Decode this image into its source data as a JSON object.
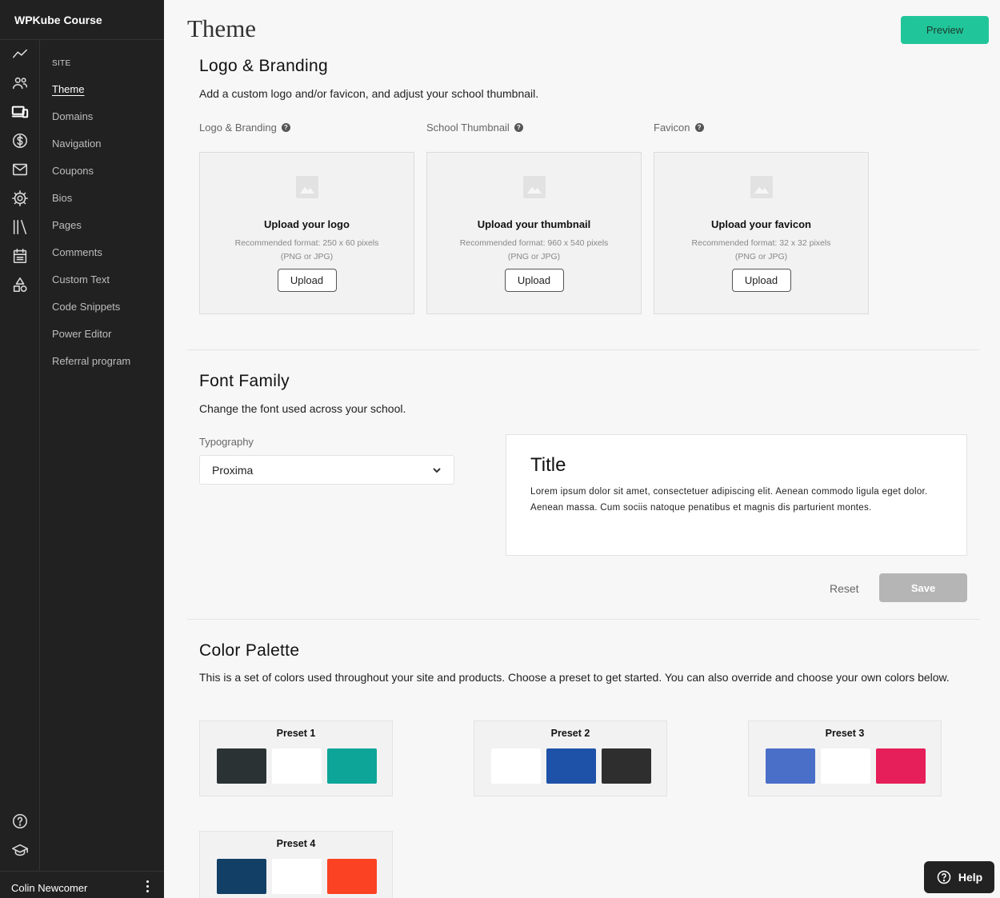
{
  "app": {
    "title": "WPKube Course"
  },
  "rail": {
    "icons": [
      "analytics-icon",
      "users-icon",
      "devices-icon",
      "dollar-icon",
      "mail-icon",
      "settings-icon",
      "library-icon",
      "calendar-icon",
      "shapes-icon",
      "help-circle-icon",
      "graduation-cap-icon"
    ]
  },
  "subnav": {
    "section": "SITE",
    "items": [
      "Theme",
      "Domains",
      "Navigation",
      "Coupons",
      "Bios",
      "Pages",
      "Comments",
      "Custom Text",
      "Code Snippets",
      "Power Editor",
      "Referral program"
    ],
    "active": "Theme"
  },
  "user": {
    "name": "Colin Newcomer"
  },
  "header": {
    "title": "Theme",
    "preview_label": "Preview"
  },
  "branding": {
    "title": "Logo & Branding",
    "description": "Add a custom logo and/or favicon, and adjust your school thumbnail.",
    "cards": [
      {
        "label": "Logo & Branding",
        "title": "Upload your logo",
        "rec": "Recommended format: 250 x 60 pixels",
        "fmt": "(PNG or JPG)",
        "button": "Upload"
      },
      {
        "label": "School Thumbnail",
        "title": "Upload your thumbnail",
        "rec": "Recommended format: 960 x 540 pixels",
        "fmt": "(PNG or JPG)",
        "button": "Upload"
      },
      {
        "label": "Favicon",
        "title": "Upload your favicon",
        "rec": "Recommended format: 32 x 32 pixels",
        "fmt": "(PNG or JPG)",
        "button": "Upload"
      }
    ]
  },
  "font": {
    "title": "Font Family",
    "description": "Change the font used across your school.",
    "typography_label": "Typography",
    "selected": "Proxima",
    "preview_title": "Title",
    "preview_body": "Lorem ipsum dolor sit amet, consectetuer adipiscing elit. Aenean commodo ligula eget dolor. Aenean massa. Cum sociis natoque penatibus et magnis dis parturient montes.",
    "reset_label": "Reset",
    "save_label": "Save"
  },
  "palette": {
    "title": "Color Palette",
    "description": "This is a set of colors used throughout your site and products. Choose a preset to get started. You can also override and choose your own colors below.",
    "presets": [
      {
        "name": "Preset 1",
        "colors": [
          "#2b3234",
          "#ffffff",
          "#0ea599"
        ]
      },
      {
        "name": "Preset 2",
        "colors": [
          "#ffffff",
          "#1e52a8",
          "#2e2e2e"
        ]
      },
      {
        "name": "Preset 3",
        "colors": [
          "#4a6fc9",
          "#ffffff",
          "#e61e59"
        ]
      },
      {
        "name": "Preset 4",
        "colors": [
          "#123f66",
          "#ffffff",
          "#fb4222"
        ]
      }
    ]
  },
  "help": {
    "label": "Help"
  },
  "colors": {
    "accent": "#21c59a",
    "sidebar": "#212121"
  }
}
